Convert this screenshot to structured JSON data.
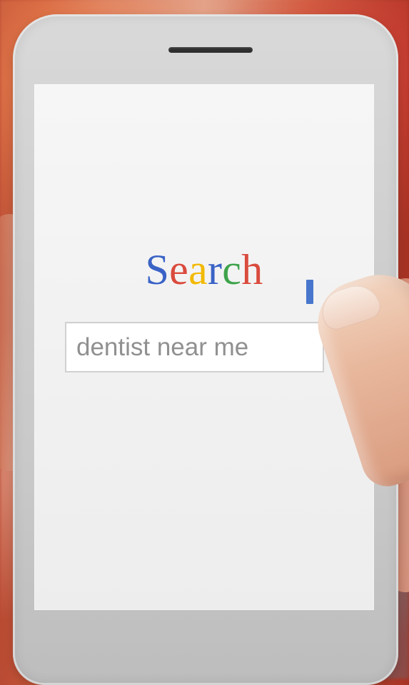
{
  "screen": {
    "title_letters": [
      {
        "char": "S",
        "color": "#3b63c6"
      },
      {
        "char": "e",
        "color": "#d94b3d"
      },
      {
        "char": "a",
        "color": "#f2b900"
      },
      {
        "char": "r",
        "color": "#3b63c6"
      },
      {
        "char": "c",
        "color": "#3ea34b"
      },
      {
        "char": "h",
        "color": "#d94b3d"
      }
    ],
    "search": {
      "value": "dentist near me"
    }
  },
  "icons": {
    "speaker": "speaker-slot"
  }
}
